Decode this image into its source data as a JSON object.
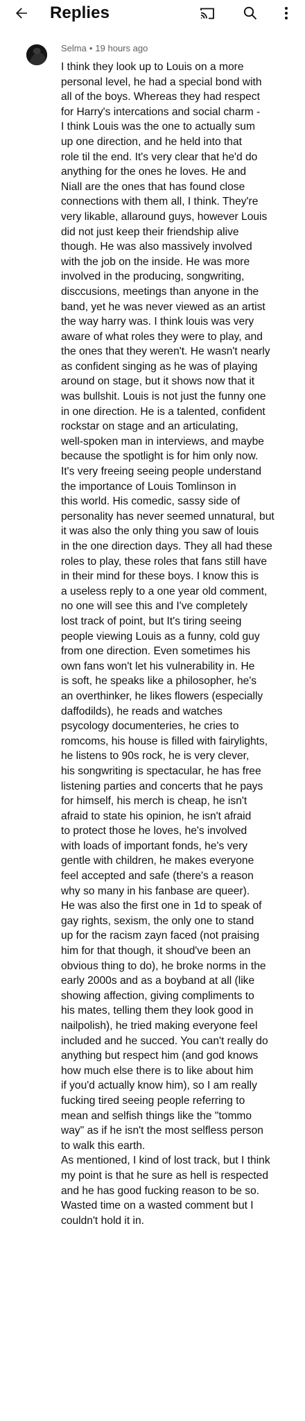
{
  "header": {
    "title": "Replies",
    "back_icon": "arrow-left-icon",
    "cast_icon": "cast-icon",
    "search_icon": "search-icon",
    "more_icon": "more-vert-icon"
  },
  "comment": {
    "author": "Selma",
    "separator": "•",
    "time": "19 hours ago",
    "lines": [
      "I think they look up to Louis on a more",
      "personal level, he had a special bond with",
      "all of the boys. Whereas they had respect",
      "for Harry's intercations and social charm -",
      "I think Louis was the one to actually sum",
      "up one direction, and he held into that",
      "role til the end. It's very clear that he'd do",
      "anything for the ones he loves. He and",
      "Niall are the ones that has found close",
      "connections with them all, I think. They're",
      "very likable, allaround guys, however Louis",
      "did not just keep their friendship alive",
      "though. He was also massively involved",
      "with the job on the inside. He was more",
      "involved in the producing, songwriting,",
      "disccusions, meetings than anyone in the",
      "band, yet he was never viewed as an artist",
      "the way harry was. I think louis was very",
      "aware of what roles they were to play, and",
      "the ones that they weren't. He wasn't nearly",
      "as confident singing as he was of playing",
      "around on stage, but it shows now that it",
      "was bullshit. Louis is not just the funny one",
      "in one direction. He is a talented, confident",
      "rockstar on stage and an articulating,",
      "well-spoken man in interviews, and maybe",
      "because the spotlight is for him only now.",
      "It's very freeing seeing people understand",
      "the importance of Louis Tomlinson in",
      "this world. His comedic, sassy side of",
      "personality has never seemed unnatural, but",
      "it was also the only thing you saw of louis",
      "in the one direction days. They all had these",
      "roles to play, these roles that fans still have",
      "in their mind for these boys. I know this is",
      "a useless reply to a one year old comment,",
      "no one will see this and I've completely",
      "lost track of point, but It's tiring seeing",
      "people viewing Louis as a funny, cold guy",
      "from one direction. Even sometimes his",
      "own fans won't let his vulnerability in. He",
      "is soft, he speaks like a philosopher, he's",
      "an overthinker, he likes flowers (especially",
      "daffodilds), he reads and watches",
      "psycology documenteries, he cries to",
      "romcoms, his house is filled with fairylights,",
      "he listens to 90s rock, he is very clever,",
      "his songwriting is spectacular, he has free",
      "listening parties and concerts that he pays",
      "for himself, his merch is cheap, he isn't",
      "afraid to state his opinion, he isn't afraid",
      "to protect those he loves, he's involved",
      "with loads of important fonds, he's very",
      "gentle with children, he makes everyone",
      "feel accepted and safe (there's a reason",
      "why so many in his fanbase are queer).",
      "He was also the first one in 1d to speak of",
      "gay rights, sexism, the only one to stand",
      "up for the racism zayn faced (not praising",
      "him for that though, it shoud've been an",
      "obvious thing to do), he broke norms in the",
      "early 2000s and as a boyband at all (like",
      "showing affection, giving compliments to",
      "his mates, telling them they look good in",
      "nailpolish), he tried making everyone feel",
      "included and he succed. You can't really do",
      "anything but respect him (and god knows",
      "how much else there is to like about him",
      "if you'd actually know him), so I am really",
      "fucking tired seeing people referring to",
      "mean and selfish things like the \"tommo",
      "way\" as if he isn't the most selfless person",
      "to walk this earth.",
      "As mentioned, I kind of lost track, but I think",
      "my point is that he sure as hell is respected",
      "and he has good fucking reason to be so.",
      "Wasted time on a wasted comment but I",
      "couldn't hold it in."
    ]
  },
  "colors": {
    "text": "#0f0f0f",
    "meta": "#606060",
    "background": "#ffffff"
  }
}
